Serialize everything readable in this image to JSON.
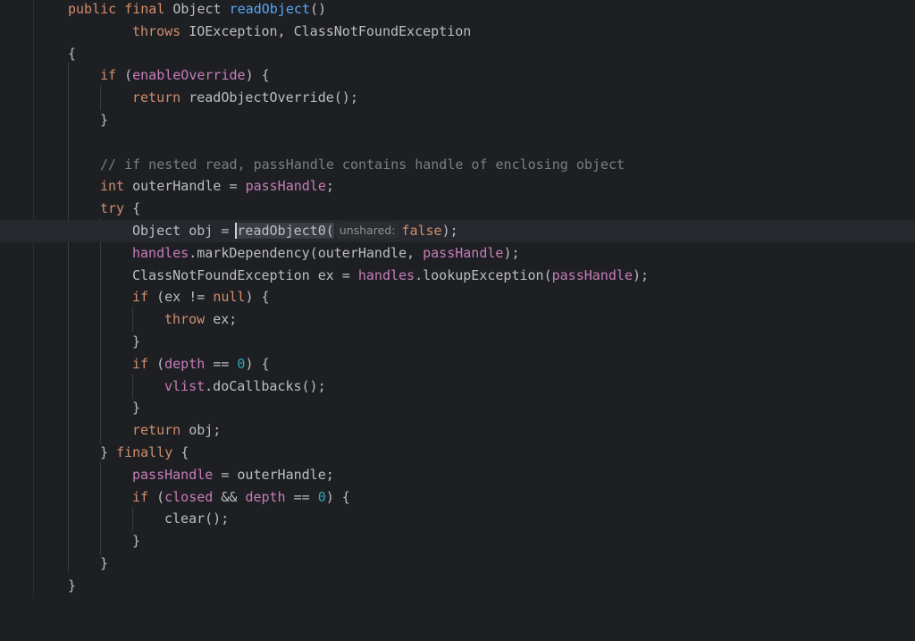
{
  "code": {
    "l1_public": "public",
    "l1_final": "final",
    "l1_type": "Object",
    "l1_method": "readObject",
    "l1_parens": "()",
    "l2_throws": "throws",
    "l2_exceptions": "IOException, ClassNotFoundException",
    "l3": "{",
    "l4_if": "if",
    "l4_open": "(",
    "l4_field": "enableOverride",
    "l4_close": ") {",
    "l5_return": "return",
    "l5_call": "readObjectOverride();",
    "l6": "}",
    "l8_comment": "// if nested read, passHandle contains handle of enclosing object",
    "l9_int": "int",
    "l9_decl": "outerHandle =",
    "l9_field": "passHandle",
    "l9_semi": ";",
    "l10_try": "try",
    "l10_brace": "{",
    "l11_decl": "Object obj =",
    "l11_call": "readObject0(",
    "l11_hint": "unshared:",
    "l11_false": "false",
    "l11_end": ");",
    "l12_field": "handles",
    "l12_call": ".markDependency(outerHandle,",
    "l12_field2": "passHandle",
    "l12_end": ");",
    "l13_decl": "ClassNotFoundException ex =",
    "l13_field": "handles",
    "l13_call": ".lookupException(",
    "l13_field2": "passHandle",
    "l13_end": ");",
    "l14_if": "if",
    "l14_cond": "(ex !=",
    "l14_null": "null",
    "l14_end": ") {",
    "l15_throw": "throw",
    "l15_rest": "ex;",
    "l16": "}",
    "l17_if": "if",
    "l17_open": "(",
    "l17_field": "depth",
    "l17_op": "==",
    "l17_num": "0",
    "l17_end": ") {",
    "l18_field": "vlist",
    "l18_call": ".doCallbacks();",
    "l19": "}",
    "l20_return": "return",
    "l20_rest": "obj;",
    "l21_brace": "}",
    "l21_finally": "finally",
    "l21_open": "{",
    "l22_field": "passHandle",
    "l22_rest": "= outerHandle;",
    "l23_if": "if",
    "l23_open": "(",
    "l23_field": "closed",
    "l23_and": "&&",
    "l23_field2": "depth",
    "l23_op": "==",
    "l23_num": "0",
    "l23_end": ") {",
    "l24_call": "clear();",
    "l25": "}",
    "l26": "}",
    "l27": "}"
  },
  "colors": {
    "background": "#1e1f22",
    "text": "#bcbec4",
    "keyword": "#cf8e6d",
    "method": "#56a8f5",
    "field": "#c77dbb",
    "number": "#2aacb8",
    "comment": "#7a7e85"
  }
}
